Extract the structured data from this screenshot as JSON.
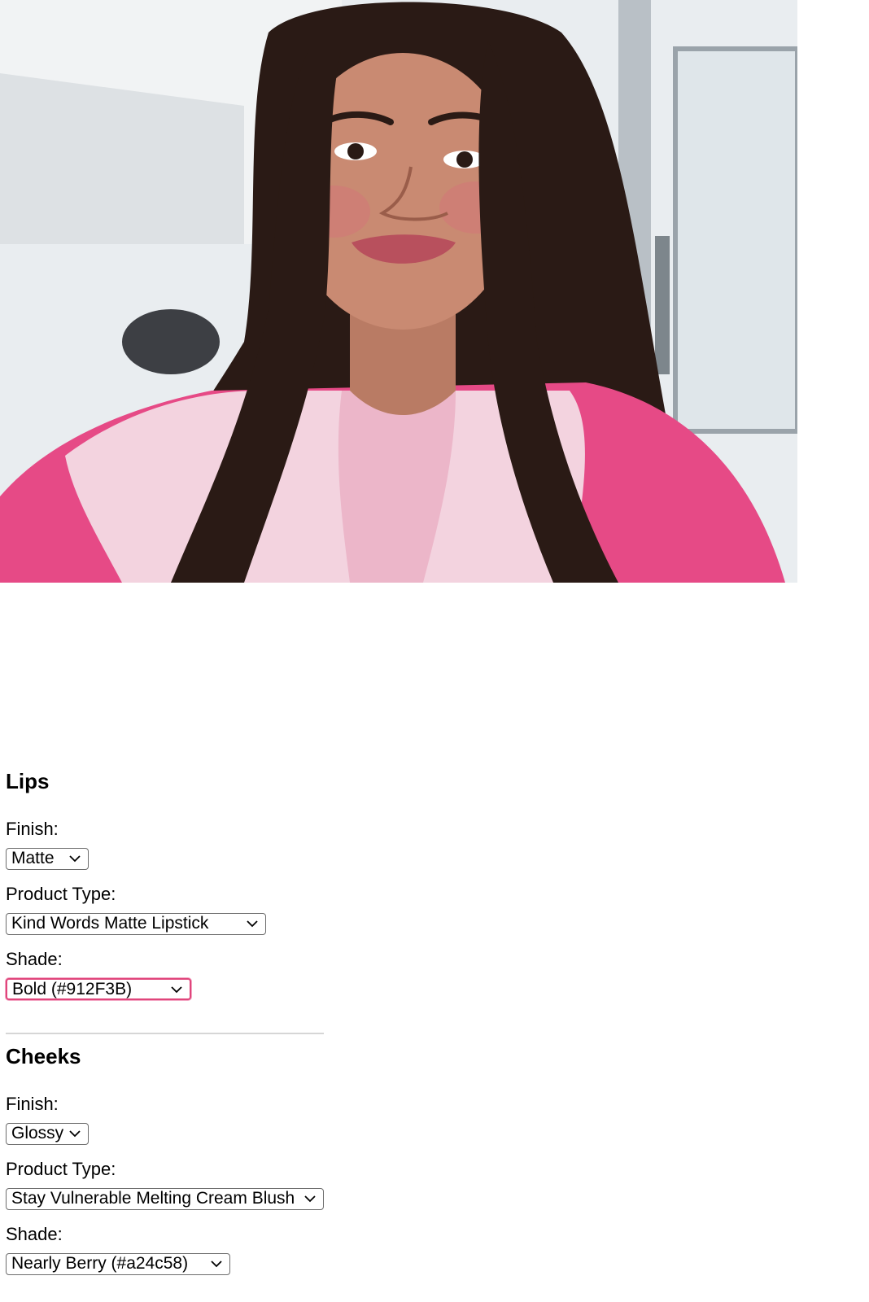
{
  "photo": {
    "alt_icon": "portrait-photo",
    "colors": {
      "wall": "#e7ebee",
      "hair": "#2a1a15",
      "skin": "#c98a72",
      "lips": "#b8505d",
      "shirt_pink": "#e64a86",
      "shirt_light": "#f3d3df"
    }
  },
  "lips": {
    "title": "Lips",
    "finish_label": "Finish:",
    "finish_value": "Matte",
    "product_type_label": "Product Type:",
    "product_type_value": "Kind Words Matte Lipstick",
    "shade_label": "Shade:",
    "shade_value": "Bold (#912F3B)"
  },
  "cheeks": {
    "title": "Cheeks",
    "finish_label": "Finish:",
    "finish_value": "Glossy",
    "product_type_label": "Product Type:",
    "product_type_value": "Stay Vulnerable Melting Cream Blush",
    "shade_label": "Shade:",
    "shade_value": "Nearly Berry (#a24c58)"
  },
  "colors": {
    "focus_ring": "#e0457b",
    "select_border": "#6d6d6d",
    "divider": "#d6d6d6"
  }
}
